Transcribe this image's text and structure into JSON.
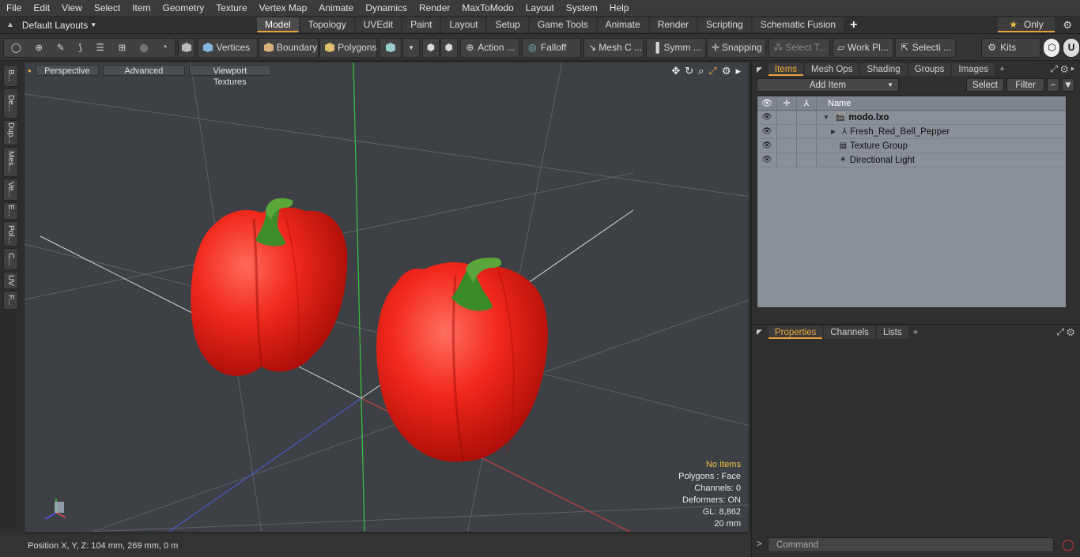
{
  "menu": [
    "File",
    "Edit",
    "View",
    "Select",
    "Item",
    "Geometry",
    "Texture",
    "Vertex Map",
    "Animate",
    "Dynamics",
    "Render",
    "MaxToModo",
    "Layout",
    "System",
    "Help"
  ],
  "layouts_label": "Default Layouts",
  "tabs": [
    "Model",
    "Topology",
    "UVEdit",
    "Paint",
    "Layout",
    "Setup",
    "Game Tools",
    "Animate",
    "Render",
    "Scripting",
    "Schematic Fusion"
  ],
  "active_tab": "Model",
  "only_label": "Only",
  "toolbar": {
    "vertices": "Vertices",
    "boundary": "Boundary",
    "polygons": "Polygons",
    "action": "Action ...",
    "falloff": "Falloff",
    "mesh": "Mesh C ...",
    "symm": "Symm ...",
    "snapping": "Snapping",
    "select_t": "Select T...",
    "work_pl": "Work Pl...",
    "selecti": "Selecti ...",
    "kits": "Kits"
  },
  "left_tabs": [
    "B...",
    "De...",
    "Dup...",
    "Mes...",
    "Ve...",
    "E...",
    "Pol...",
    "C...",
    "UV",
    "F..."
  ],
  "viewport": {
    "perspective": "Perspective",
    "advanced": "Advanced",
    "textures": "Viewport Textures",
    "info": {
      "no_items": "No Items",
      "polygons": "Polygons : Face",
      "channels": "Channels: 0",
      "deformers": "Deformers: ON",
      "gl": "GL: 8,862",
      "scale": "20 mm"
    }
  },
  "status": "Position X, Y, Z:   104 mm, 269 mm, 0 m",
  "items_panel": {
    "tabs": [
      "Items",
      "Mesh Ops",
      "Shading",
      "Groups",
      "Images"
    ],
    "add_item": "Add Item",
    "select": "Select",
    "filter": "Filter",
    "name_col": "Name",
    "tree": [
      {
        "label": "modo.lxo",
        "bold": true,
        "indent": 0
      },
      {
        "label": "Fresh_Red_Bell_Pepper",
        "indent": 1
      },
      {
        "label": "Texture Group",
        "indent": 1
      },
      {
        "label": "Directional Light",
        "indent": 1
      }
    ]
  },
  "props_panel": {
    "tabs": [
      "Properties",
      "Channels",
      "Lists"
    ]
  },
  "command_placeholder": "Command"
}
